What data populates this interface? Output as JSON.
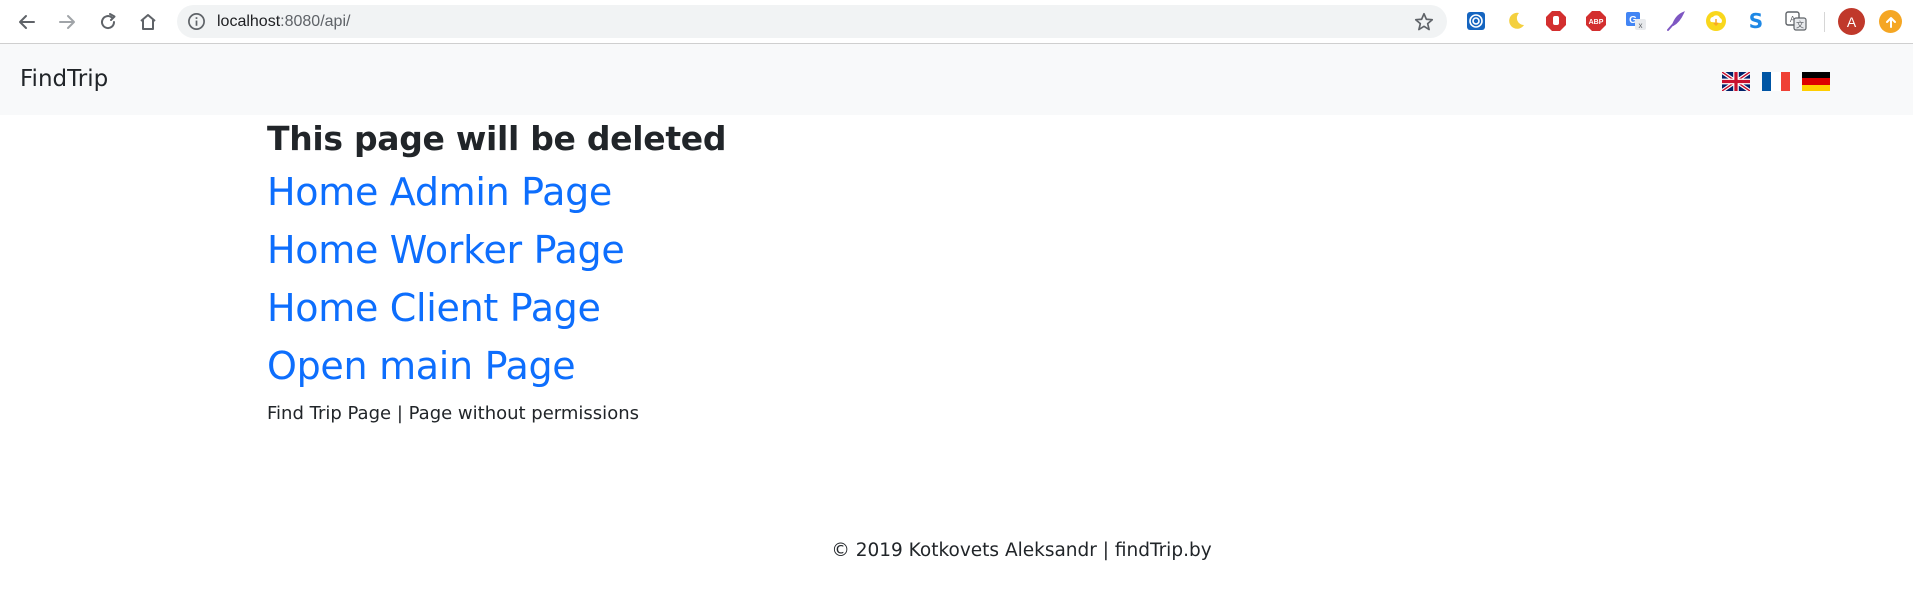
{
  "browser": {
    "url_host": "localhost",
    "url_rest": ":8080/api/",
    "profile_initial": "A",
    "extensions": [
      "target-icon",
      "moon-icon",
      "stop-hand-icon",
      "adblock-icon",
      "translate-icon",
      "quill-icon",
      "cloud-download-icon",
      "s-icon",
      "google-translate-icon"
    ]
  },
  "navbar": {
    "brand": "FindTrip",
    "languages": [
      "English",
      "Français",
      "Deutsch"
    ]
  },
  "main": {
    "title": "This page will be deleted",
    "links": [
      {
        "label": "Home Admin Page"
      },
      {
        "label": "Home Worker Page"
      },
      {
        "label": "Home Client Page"
      },
      {
        "label": "Open main Page"
      }
    ],
    "small_links": {
      "first": "Find Trip Page",
      "separator": "|",
      "second": "Page without permissions"
    }
  },
  "footer": {
    "text": "© 2019 Kotkovets Aleksandr | findTrip.by"
  },
  "colors": {
    "link": "#0d6efd",
    "navbar_bg": "#f8f9fa",
    "text": "#212529"
  }
}
